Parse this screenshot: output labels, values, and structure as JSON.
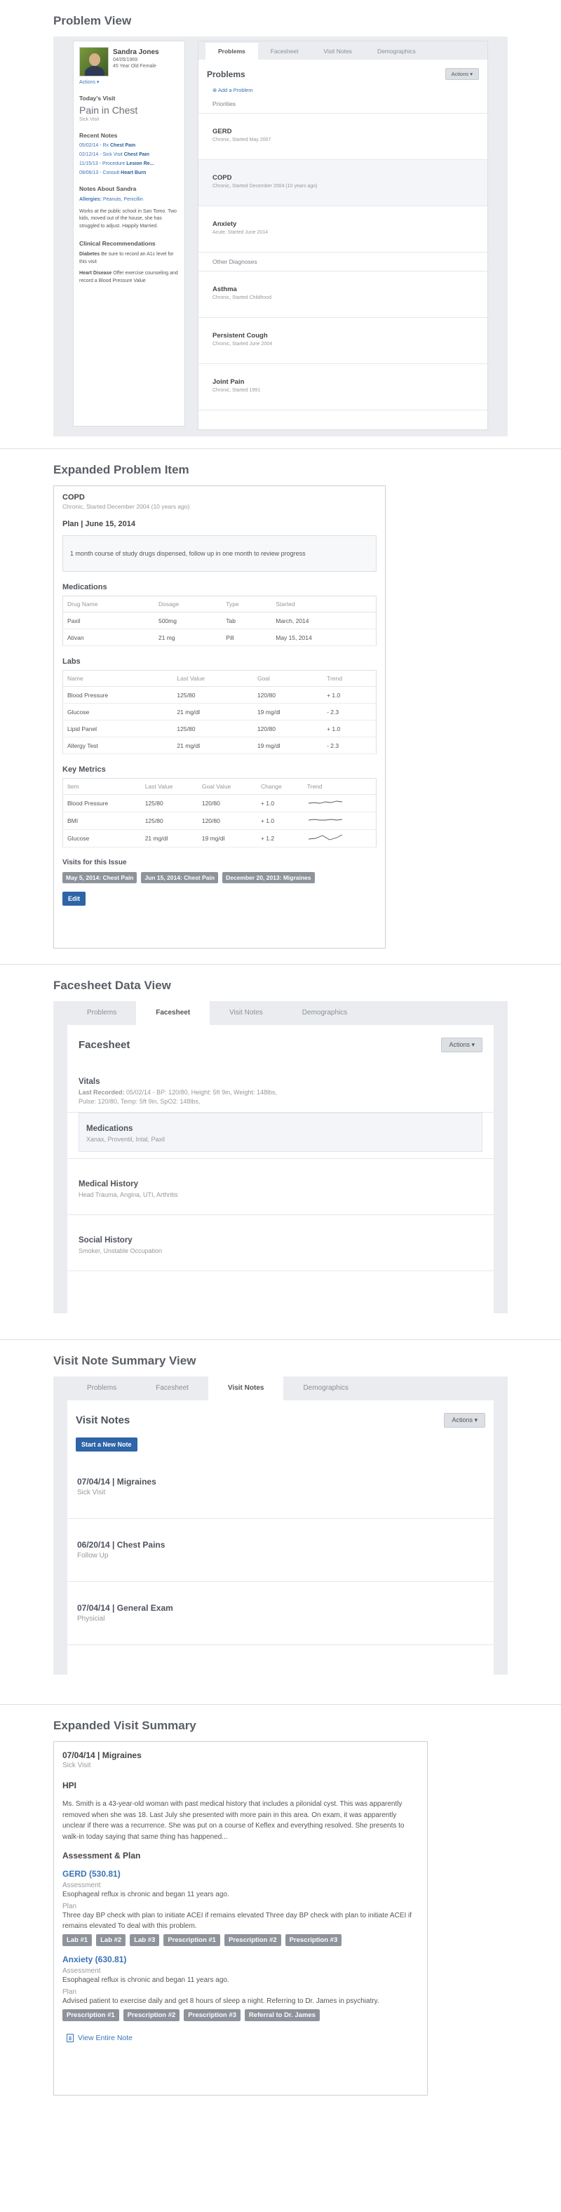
{
  "s1": {
    "title": "Problem View",
    "patient": {
      "name": "Sandra Jones",
      "dob": "04/05/1969",
      "desc": "45 Year Old Female",
      "actions": "Actions ▾"
    },
    "todays_visit": {
      "heading": "Today's Visit",
      "reason": "Pain in Chest",
      "type": "Sick Visit"
    },
    "recent_notes": {
      "heading": "Recent Notes",
      "items": [
        {
          "date": "05/02/14 - Rx",
          "label": "Chest Pain"
        },
        {
          "date": "02/12/14 - Sick Visit",
          "label": "Chest Pain"
        },
        {
          "date": "11/15/13 - Procedure",
          "label": "Lesion Re..."
        },
        {
          "date": "09/06/13 - Consult",
          "label": "Heart Burn"
        }
      ]
    },
    "notes_about": {
      "heading": "Notes About Sandra",
      "allergies_label": "Allergies:",
      "allergies": "Peanuts, Penicillin",
      "text": "Works at the public school in San Tomo. Two kids, moved out of the house, she has struggled to adjust. Happily Married."
    },
    "clinical": {
      "heading": "Clinical Recommendations",
      "items": [
        {
          "label": "Diabetes",
          "text": "Be sure to record an A1c level for this visit"
        },
        {
          "label": "Heart Disease",
          "text": "Offer exercise counseling and record a Blood Pressure Value"
        }
      ]
    },
    "tabs": [
      "Problems",
      "Facesheet",
      "Visit Notes",
      "Demographics"
    ],
    "panel_title": "Problems",
    "actions": "Actions ▾",
    "add_link": "Add a Problem",
    "priorities_label": "Priorities",
    "priorities": [
      {
        "name": "GERD",
        "detail": "Chronic, Started May 2007"
      },
      {
        "name": "COPD",
        "detail": "Chronic, Started December 2004 (10 years ago)"
      },
      {
        "name": "Anxiety",
        "detail": "Acute, Started June 2014"
      }
    ],
    "other_label": "Other Diagnoses",
    "other": [
      {
        "name": "Asthma",
        "detail": "Chronic, Started Childhood"
      },
      {
        "name": "Persistent Cough",
        "detail": "Chronic, Started June 2004"
      },
      {
        "name": "Joint Pain",
        "detail": "Chronic, Started 1991"
      }
    ]
  },
  "s2": {
    "title": "Expanded Problem Item",
    "problem": "COPD",
    "detail": "Chronic, Started December 2004 (10 years ago)",
    "plan_heading": "Plan | June 15, 2014",
    "plan_text": "1 month course of study drugs dispensed, follow up in one month to review progress",
    "meds": {
      "heading": "Medications",
      "cols": [
        "Drug Name",
        "Dosage",
        "Type",
        "Started"
      ],
      "rows": [
        [
          "Paxil",
          "500mg",
          "Tab",
          "March, 2014"
        ],
        [
          "Ativan",
          "21 mg",
          "Pill",
          "May 15, 2014"
        ]
      ]
    },
    "labs": {
      "heading": "Labs",
      "cols": [
        "Name",
        "Last Value",
        "Goal",
        "Trend"
      ],
      "rows": [
        [
          "Blood Pressure",
          "125/80",
          "120/80",
          "+ 1.0"
        ],
        [
          "Glucose",
          "21 mg/dl",
          "19 mg/dl",
          "- 2.3"
        ],
        [
          "Lipid Panel",
          "125/80",
          "120/80",
          "+ 1.0"
        ],
        [
          "Allergy Test",
          "21 mg/dl",
          "19 mg/dl",
          "- 2.3"
        ]
      ]
    },
    "metrics": {
      "heading": "Key Metrics",
      "cols": [
        "Item",
        "Last Value",
        "Goal Value",
        "Change",
        "Trend"
      ],
      "rows": [
        [
          "Blood Pressure",
          "125/80",
          "120/80",
          "+ 1.0"
        ],
        [
          "BMI",
          "125/80",
          "120/80",
          "+ 1.0"
        ],
        [
          "Glucose",
          "21 mg/dl",
          "19 mg/dl",
          "+ 1.2"
        ]
      ]
    },
    "visits_heading": "Visits for this Issue",
    "visits": [
      "May 5, 2014: Chest Pain",
      "Jun 15, 2014: Chest Pain",
      "December 20, 2013: Migraines"
    ],
    "edit": "Edit"
  },
  "s3": {
    "title": "Facesheet Data View",
    "tabs": [
      "Problems",
      "Facesheet",
      "Visit Notes",
      "Demographics"
    ],
    "panel_title": "Facesheet",
    "actions": "Actions ▾",
    "vitals": {
      "name": "Vitals",
      "label": "Last Recorded:",
      "line1": "05/02/14 - BP: 120/80, Height: 5ft 9in, Weight: 148lbs,",
      "line2": "Pulse: 120/80, Temp: 5ft 9in, SpO2: 148lbs,"
    },
    "rows": [
      {
        "name": "Medications",
        "detail": "Xanax, Proventil, Intal, Paxil"
      },
      {
        "name": "Medical History",
        "detail": "Head Trauma, Angina, UTI, Arthritis"
      },
      {
        "name": "Social History",
        "detail": "Smoker, Unstable Occupation"
      }
    ]
  },
  "s4": {
    "title": "Visit Note Summary View",
    "tabs": [
      "Problems",
      "Facesheet",
      "Visit Notes",
      "Demographics"
    ],
    "panel_title": "Visit Notes",
    "actions": "Actions ▾",
    "new_note": "Start a New Note",
    "notes": [
      {
        "title": "07/04/14 | Migraines",
        "type": "Sick Visit"
      },
      {
        "title": "06/20/14 | Chest Pains",
        "type": "Follow Up"
      },
      {
        "title": "07/04/14 | General Exam",
        "type": "Physicial"
      }
    ]
  },
  "s5": {
    "title": "Expanded Visit Summary",
    "note_title": "07/04/14 | Migraines",
    "note_type": "Sick Visit",
    "hpi_heading": "HPI",
    "hpi": "Ms. Smith is a 43-year-old woman with past medical history that includes a pilonidal cyst. This was apparently removed when she was 18. Last July she presented with more pain in this area. On exam, it was apparently unclear if there was a recurrence. She was put on a course of Keflex and everything resolved. She presents to walk-in today saying that same thing has happened...",
    "ap_heading": "Assessment & Plan",
    "dx": [
      {
        "name": "GERD (530.81)",
        "assess_label": "Assessment",
        "assess": "Esophageal reflux is chronic and began 11 years ago.",
        "plan_label": "Plan",
        "plan": "Three day BP check with plan to initiate ACEI if remains elevated Three day BP check with plan to initiate ACEI if remains elevated To deal with this problem.",
        "tags": [
          "Lab #1",
          "Lab #2",
          "Lab #3",
          "Prescription #1",
          "Prescription #2",
          "Prescription #3"
        ]
      },
      {
        "name": "Anxiety (630.81)",
        "assess_label": "Assessment",
        "assess": "Esophageal reflux is chronic and began 11 years ago.",
        "plan_label": "Plan",
        "plan": "Advised patient to exercise daily and get 8 hours of sleep a night. Referring to Dr. James in psychiatry.",
        "tags": [
          "Prescription #1",
          "Prescription #2",
          "Prescription #3",
          "Referral to Dr. James"
        ]
      }
    ],
    "view_link": "View Entire Note"
  }
}
